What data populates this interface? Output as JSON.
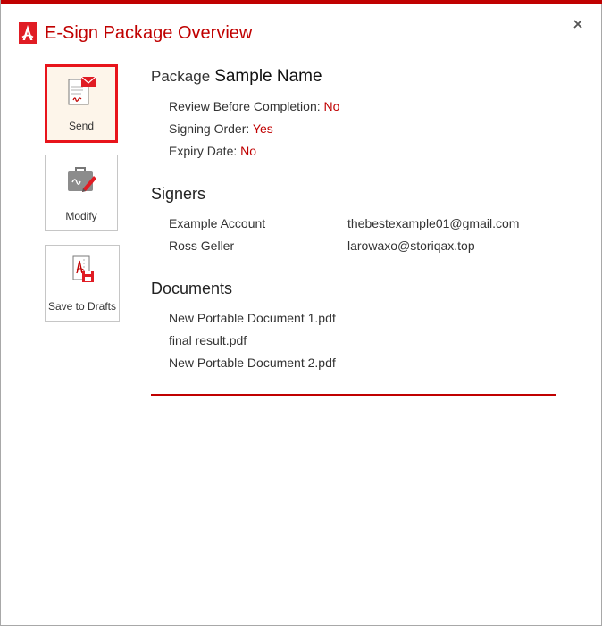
{
  "window": {
    "title": "E-Sign Package Overview",
    "accent_color": "#c00000"
  },
  "icons": {
    "logo": "acrobat-logo-icon",
    "close": "close-icon",
    "send": "envelope-document-icon",
    "modify": "briefcase-pen-icon",
    "save": "document-save-icon"
  },
  "actions": {
    "send_label": "Send",
    "modify_label": "Modify",
    "save_label": "Save to Drafts"
  },
  "package": {
    "prefix": "Package",
    "name": "Sample Name",
    "review_label": "Review Before Completion:",
    "review_value": "No",
    "signing_order_label": "Signing Order:",
    "signing_order_value": "Yes",
    "expiry_label": "Expiry Date:",
    "expiry_value": "No"
  },
  "signers": {
    "heading": "Signers",
    "items": [
      {
        "name": "Example Account",
        "email": "thebestexample01@gmail.com"
      },
      {
        "name": "Ross Geller",
        "email": "larowaxo@storiqax.top"
      }
    ]
  },
  "documents": {
    "heading": "Documents",
    "items": [
      "New Portable Document 1.pdf",
      "final result.pdf",
      "New Portable Document 2.pdf"
    ]
  }
}
